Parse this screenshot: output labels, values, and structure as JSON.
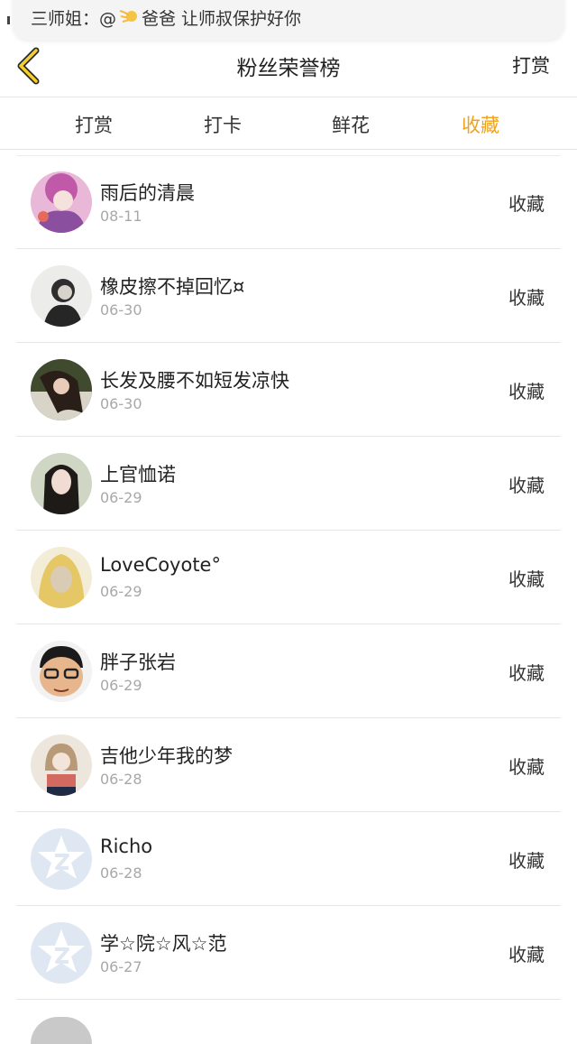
{
  "notification": {
    "text_before": "三师姐：@",
    "text_after": "爸爸 让师叔保护好你"
  },
  "navbar": {
    "title": "粉丝荣誉榜",
    "action": "打赏"
  },
  "tabs": [
    {
      "label": "打赏"
    },
    {
      "label": "打卡"
    },
    {
      "label": "鲜花"
    },
    {
      "label": "收藏"
    }
  ],
  "active_tab": "收藏",
  "accent_color": "#f0a21b",
  "rows": [
    {
      "name": "雨后的清晨",
      "date": "08-11",
      "action": "收藏"
    },
    {
      "name": "橡皮擦不掉回忆¤",
      "date": "06-30",
      "action": "收藏"
    },
    {
      "name": "长发及腰不如短发凉快",
      "date": "06-30",
      "action": "收藏"
    },
    {
      "name": "上官恤诺",
      "date": "06-29",
      "action": "收藏"
    },
    {
      "name": "LoveCoyote°",
      "date": "06-29",
      "action": "收藏"
    },
    {
      "name": "胖子张岩",
      "date": "06-29",
      "action": "收藏"
    },
    {
      "name": "吉他少年我的梦",
      "date": "06-28",
      "action": "收藏"
    },
    {
      "name": "Richo",
      "date": "06-28",
      "action": "收藏"
    },
    {
      "name": "学☆院☆风☆范",
      "date": "06-27",
      "action": "收藏"
    }
  ]
}
